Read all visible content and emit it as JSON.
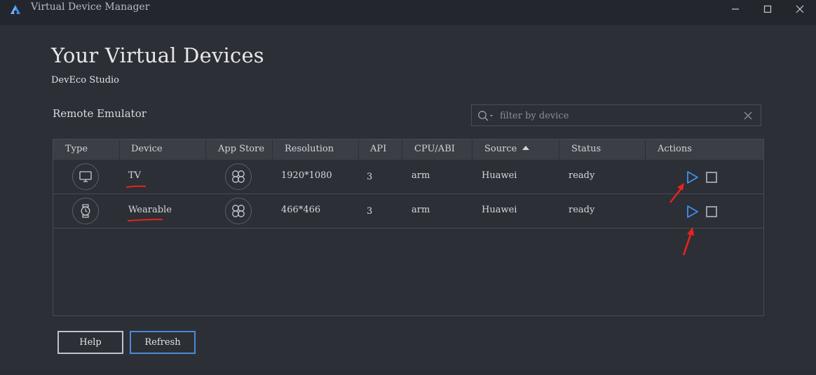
{
  "window": {
    "title": "Virtual Device Manager",
    "controls": {
      "minimize": "minimize-icon",
      "maximize": "maximize-icon",
      "close": "close-icon"
    }
  },
  "page": {
    "heading": "Your Virtual Devices",
    "subheading": "DevEco Studio",
    "section": "Remote Emulator"
  },
  "search": {
    "placeholder": "filter by device",
    "value": ""
  },
  "table": {
    "columns": [
      "Type",
      "Device",
      "App Store",
      "Resolution",
      "API",
      "CPU/ABI",
      "Source",
      "Status",
      "Actions"
    ],
    "sorted_column": "Source",
    "sort_direction": "ascending",
    "rows": [
      {
        "type_icon": "tv-icon",
        "device": "TV",
        "app_store_icon": "app-store-icon",
        "resolution": "1920*1080",
        "api": "3",
        "cpu": "arm",
        "source": "Huawei",
        "status": "ready"
      },
      {
        "type_icon": "watch-icon",
        "device": "Wearable",
        "app_store_icon": "app-store-icon",
        "resolution": "466*466",
        "api": "3",
        "cpu": "arm",
        "source": "Huawei",
        "status": "ready"
      }
    ]
  },
  "buttons": {
    "help": "Help",
    "refresh": "Refresh"
  },
  "colors": {
    "background": "#2c2f36",
    "titlebar": "#23262c",
    "header": "#3b3e45",
    "play": "#3d8ff0",
    "annotation": "#e8231d",
    "primary_border": "#4b8ad6"
  }
}
